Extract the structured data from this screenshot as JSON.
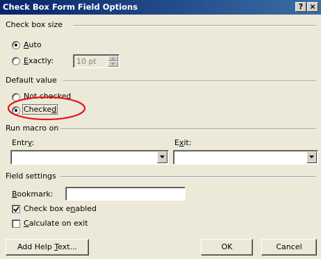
{
  "window": {
    "title": "Check Box Form Field Options",
    "help_label": "?",
    "close_label": "×"
  },
  "check_box_size": {
    "heading": "Check box size",
    "auto": {
      "pre": "",
      "u": "A",
      "post": "uto",
      "selected": true
    },
    "exactly": {
      "pre": "",
      "u": "E",
      "post": "xactly:",
      "selected": false
    },
    "size_value": "10 pt"
  },
  "default_value": {
    "heading": "Default value",
    "not_checked": {
      "label": "Not checked",
      "selected": false
    },
    "checked": {
      "pre": "Checke",
      "u": "d",
      "post": "",
      "selected": true
    }
  },
  "run_macro": {
    "heading": "Run macro on",
    "entry": {
      "pre": "Entr",
      "u": "y",
      "post": ":",
      "value": ""
    },
    "exit": {
      "pre": "E",
      "u": "x",
      "post": "it:",
      "value": ""
    }
  },
  "field_settings": {
    "heading": "Field settings",
    "bookmark": {
      "pre": "",
      "u": "B",
      "post": "ookmark:",
      "value": ""
    },
    "enabled": {
      "pre": "Check box e",
      "u": "n",
      "post": "abled",
      "checked": true
    },
    "calculate": {
      "pre": "",
      "u": "C",
      "post": "alculate on exit",
      "checked": false
    }
  },
  "buttons": {
    "help": {
      "pre": "Add Help ",
      "u": "T",
      "post": "ext..."
    },
    "ok": "OK",
    "cancel": "Cancel"
  },
  "annotation_color": "#e8141c"
}
